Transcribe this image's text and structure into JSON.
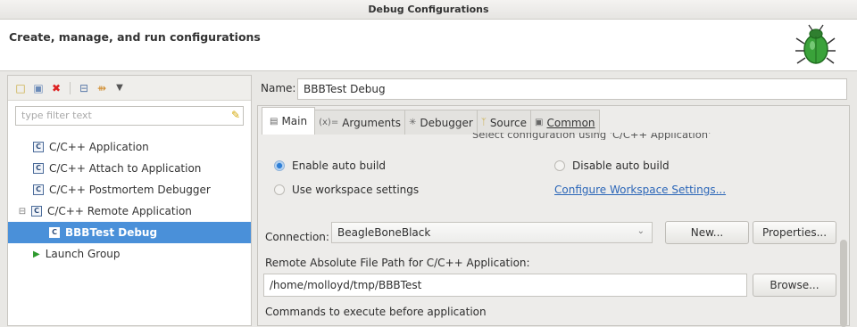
{
  "window": {
    "title": "Debug Configurations"
  },
  "header": {
    "text": "Create, manage, and run configurations"
  },
  "sidebar": {
    "filter_placeholder": "type filter text",
    "items": [
      {
        "label": "C/C++ Application"
      },
      {
        "label": "C/C++ Attach to Application"
      },
      {
        "label": "C/C++ Postmortem Debugger"
      },
      {
        "label": "C/C++ Remote Application"
      },
      {
        "label": "BBBTest Debug"
      },
      {
        "label": "Launch Group"
      }
    ]
  },
  "config": {
    "name_label": "Name:",
    "name_value": "BBBTest Debug",
    "tabs": [
      {
        "label": "Main",
        "icon": "main-tab-icon"
      },
      {
        "label": "Arguments",
        "icon": "arguments-icon"
      },
      {
        "label": "Debugger",
        "icon": "debugger-icon"
      },
      {
        "label": "Source",
        "icon": "source-icon"
      },
      {
        "label": "Common",
        "icon": "common-icon"
      }
    ],
    "cut_text": "Select configuration using 'C/C++ Application'",
    "enable_auto_build": "Enable auto build",
    "disable_auto_build": "Disable auto build",
    "use_workspace_settings": "Use workspace settings",
    "configure_workspace_link": "Configure Workspace Settings...",
    "connection_label": "Connection:",
    "connection_value": "BeagleBoneBlack",
    "new_button": "New...",
    "properties_button": "Properties...",
    "remote_path_label": "Remote Absolute File Path for C/C++ Application:",
    "remote_path_value": "/home/molloyd/tmp/BBBTest",
    "browse_button": "Browse...",
    "commands_label": "Commands to execute before application"
  }
}
